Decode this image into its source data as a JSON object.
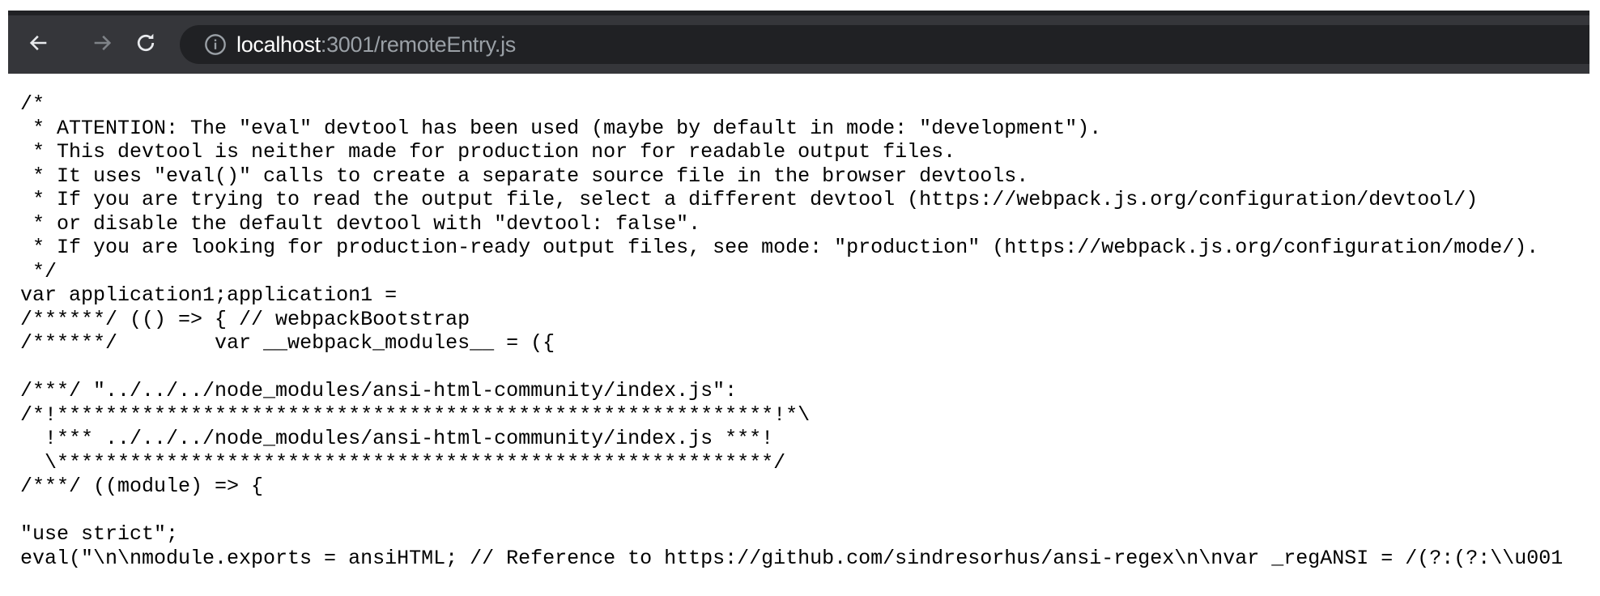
{
  "browser": {
    "url_host": "localhost",
    "url_rest": ":3001/remoteEntry.js",
    "icons": {
      "back": "arrow-left-icon",
      "forward": "arrow-right-icon",
      "reload": "reload-icon",
      "info": "info-icon"
    }
  },
  "code_lines": [
    "/*",
    " * ATTENTION: The \"eval\" devtool has been used (maybe by default in mode: \"development\").",
    " * This devtool is neither made for production nor for readable output files.",
    " * It uses \"eval()\" calls to create a separate source file in the browser devtools.",
    " * If you are trying to read the output file, select a different devtool (https://webpack.js.org/configuration/devtool/)",
    " * or disable the default devtool with \"devtool: false\".",
    " * If you are looking for production-ready output files, see mode: \"production\" (https://webpack.js.org/configuration/mode/).",
    " */",
    "var application1;application1 =",
    "/******/ (() => { // webpackBootstrap",
    "/******/ \tvar __webpack_modules__ = ({",
    "",
    "/***/ \"../../../node_modules/ansi-html-community/index.js\":",
    "/*!***********************************************************!*\\",
    "  !*** ../../../node_modules/ansi-html-community/index.js ***!",
    "  \\***********************************************************/",
    "/***/ ((module) => {",
    "",
    "\"use strict\";",
    "eval(\"\\n\\nmodule.exports = ansiHTML; // Reference to https://github.com/sindresorhus/ansi-regex\\n\\nvar _regANSI = /(?:(?:\\\\u001"
  ]
}
